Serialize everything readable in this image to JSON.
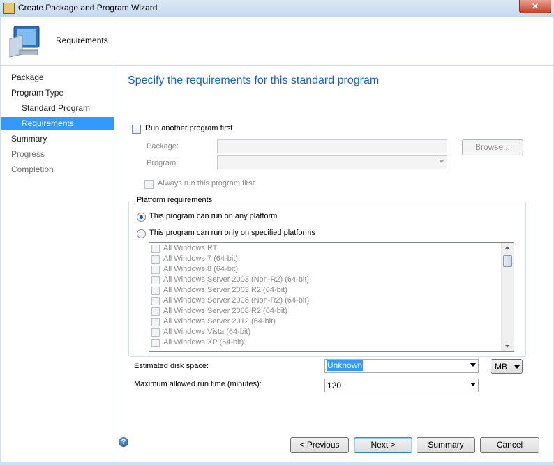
{
  "window": {
    "title": "Create Package and Program Wizard",
    "close_glyph": "✕"
  },
  "header": {
    "title": "Requirements",
    "icon": "computer-icon"
  },
  "nav": {
    "items": [
      {
        "label": "Package",
        "level": 1,
        "state": "normal"
      },
      {
        "label": "Program Type",
        "level": 1,
        "state": "normal"
      },
      {
        "label": "Standard Program",
        "level": 2,
        "state": "normal"
      },
      {
        "label": "Requirements",
        "level": 2,
        "state": "selected"
      },
      {
        "label": "Summary",
        "level": 1,
        "state": "normal"
      },
      {
        "label": "Progress",
        "level": 1,
        "state": "dimmed"
      },
      {
        "label": "Completion",
        "level": 1,
        "state": "dimmed"
      }
    ]
  },
  "main": {
    "page_title": "Specify the requirements for this standard program",
    "run_another": {
      "label": "Run another program first",
      "checked": false
    },
    "package_label": "Package:",
    "package_value": "",
    "browse_label": "Browse...",
    "program_label": "Program:",
    "program_value": "",
    "always_run": {
      "label": "Always run this program first",
      "checked": false
    },
    "platform": {
      "legend": "Platform requirements",
      "option_any": "This program can run on any platform",
      "option_specified": "This program can run only on specified platforms",
      "selected_option": "any",
      "platforms": [
        "All Windows RT",
        "All Windows 7 (64-bit)",
        "All Windows 8 (64-bit)",
        "All Windows Server 2003 (Non-R2) (64-bit)",
        "All Windows Server 2003 R2 (64-bit)",
        "All Windows Server 2008 (Non-R2) (64-bit)",
        "All Windows Server 2008 R2 (64-bit)",
        "All Windows Server 2012 (64-bit)",
        "All Windows Vista (64-bit)",
        "All Windows XP (64-bit)"
      ]
    },
    "disk_space": {
      "label": "Estimated disk space:",
      "value": "Unknown",
      "unit": "MB"
    },
    "max_runtime": {
      "label": "Maximum allowed run time (minutes):",
      "value": "120"
    }
  },
  "footer": {
    "help_glyph": "?",
    "previous_label": "< Previous",
    "next_label": "Next >",
    "summary_label": "Summary",
    "cancel_label": "Cancel"
  },
  "colors": {
    "accent": "#3399ff",
    "title_blue": "#1a63b7"
  }
}
